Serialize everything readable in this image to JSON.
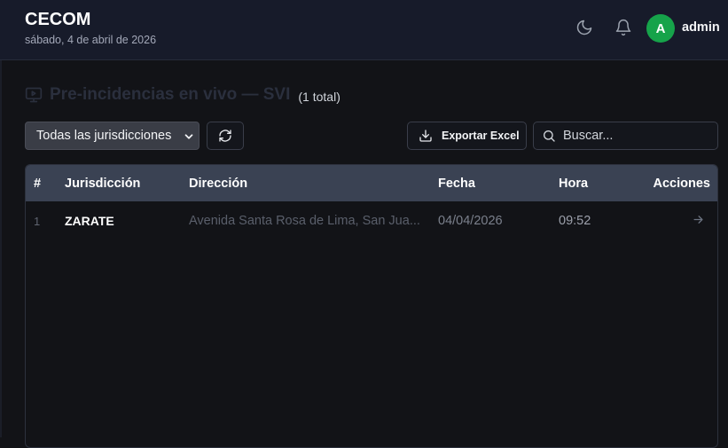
{
  "header": {
    "title": "CECOM",
    "date": "sábado, 4 de abril de 2026",
    "user": {
      "initial": "A",
      "name": "admin"
    },
    "icons": [
      "moon-icon",
      "bell-icon"
    ]
  },
  "page": {
    "title": "Pre-incidencias en vivo — SVI",
    "count": "(1 total)",
    "icon": "monitor-play-icon"
  },
  "toolbar": {
    "jurisdiction_select": {
      "selected": "Todas las jurisdicciones"
    },
    "export_label": "Exportar Excel",
    "search_placeholder": "Buscar..."
  },
  "table": {
    "columns": [
      "#",
      "Jurisdicción",
      "Dirección",
      "Fecha",
      "Hora",
      "Acciones"
    ],
    "rows": [
      {
        "index": "1",
        "jurisdiccion": "ZARATE",
        "direccion": "Avenida Santa Rosa de Lima, San Jua...",
        "fecha": "04/04/2026",
        "hora": "09:52",
        "action_icon": "arrow-right-icon"
      }
    ]
  },
  "colors": {
    "header_bg": "#171b2a",
    "page_bg": "#121317",
    "table_header_bg": "#3a4253",
    "avatar_bg": "#16a34a"
  }
}
